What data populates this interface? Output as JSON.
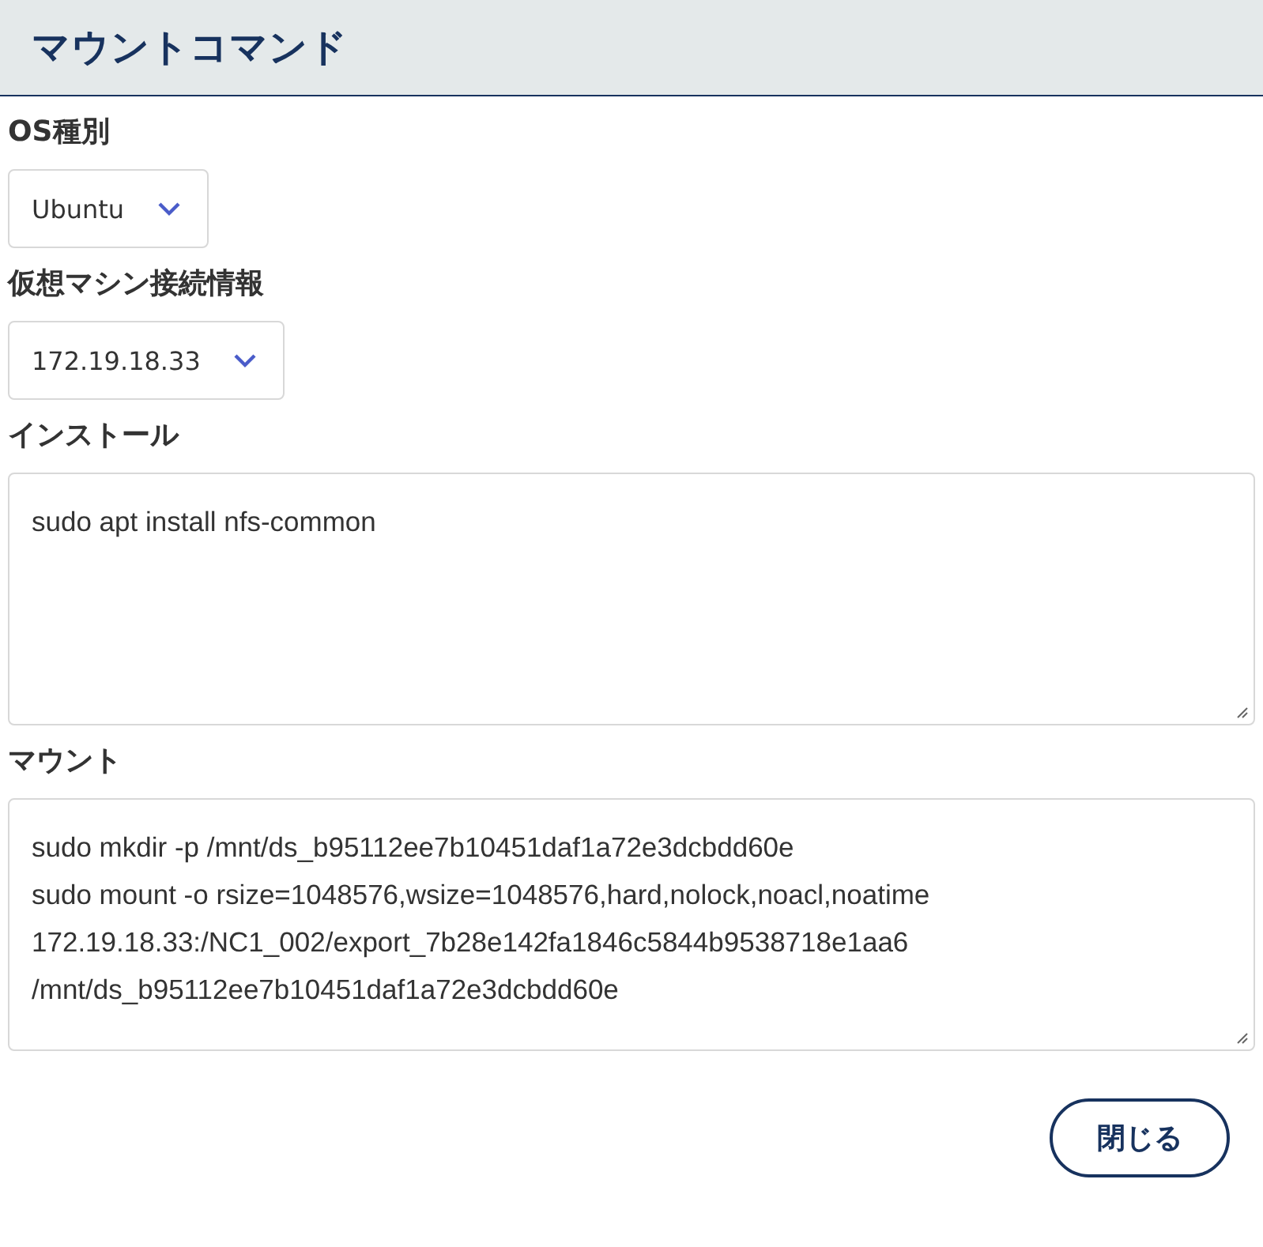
{
  "header": {
    "title": "マウントコマンド"
  },
  "fields": [
    {
      "kind": "select",
      "label": "OS種別",
      "value": "Ubuntu"
    },
    {
      "kind": "select",
      "label": "仮想マシン接続情報",
      "value": "172.19.18.33"
    },
    {
      "kind": "textarea",
      "label": "インストール",
      "lines": [
        "sudo apt install nfs-common"
      ]
    },
    {
      "kind": "textarea",
      "label": "マウント",
      "lines": [
        "sudo mkdir -p /mnt/ds_b95112ee7b10451daf1a72e3dcbdd60e",
        "sudo mount -o rsize=1048576,wsize=1048576,hard,nolock,noacl,noatime",
        "172.19.18.33:/NC1_002/export_7b28e142fa1846c5844b9538718e1aa6",
        "/mnt/ds_b95112ee7b10451daf1a72e3dcbdd60e"
      ]
    }
  ],
  "buttons": [
    {
      "label": "閉じる"
    }
  ]
}
